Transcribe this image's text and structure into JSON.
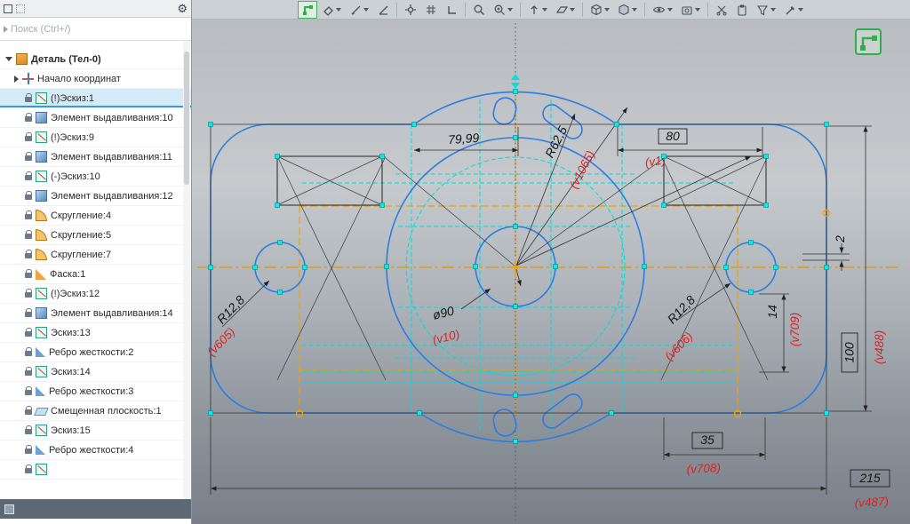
{
  "sidebar": {
    "search": {
      "placeholder": "Поиск (Ctrl+/)"
    },
    "tree": [
      {
        "label": "Деталь (Тел-0)",
        "type": "part"
      },
      {
        "label": "Начало координат",
        "type": "origin"
      },
      {
        "label": "(!)Эскиз:1",
        "type": "sketch",
        "selected": true,
        "locked": true
      },
      {
        "label": "Элемент выдавливания:10",
        "type": "extrude",
        "locked": true
      },
      {
        "label": "(!)Эскиз:9",
        "type": "sketch",
        "locked": true
      },
      {
        "label": "Элемент выдавливания:11",
        "type": "extrude",
        "locked": true
      },
      {
        "label": "(-)Эскиз:10",
        "type": "sketch",
        "locked": true
      },
      {
        "label": "Элемент выдавливания:12",
        "type": "extrude",
        "locked": true
      },
      {
        "label": "Скругление:4",
        "type": "fillet",
        "locked": true
      },
      {
        "label": "Скругление:5",
        "type": "fillet",
        "locked": true
      },
      {
        "label": "Скругление:7",
        "type": "fillet",
        "locked": true
      },
      {
        "label": "Фаска:1",
        "type": "chamfer",
        "locked": true
      },
      {
        "label": "(!)Эскиз:12",
        "type": "sketch",
        "locked": true
      },
      {
        "label": "Элемент выдавливания:14",
        "type": "extrude",
        "locked": true
      },
      {
        "label": "Эскиз:13",
        "type": "sketch",
        "locked": true
      },
      {
        "label": "Ребро жесткости:2",
        "type": "rib",
        "locked": true
      },
      {
        "label": "Эскиз:14",
        "type": "sketch",
        "locked": true
      },
      {
        "label": "Ребро жесткости:3",
        "type": "rib",
        "locked": true
      },
      {
        "label": "Смещенная плоскость:1",
        "type": "plane",
        "locked": true
      },
      {
        "label": "Эскиз:15",
        "type": "sketch",
        "locked": true
      },
      {
        "label": "Ребро жесткости:4",
        "type": "rib",
        "locked": true
      },
      {
        "label": "",
        "type": "sketch",
        "locked": true
      }
    ]
  },
  "toolbar": {
    "buttons": [
      "sketch-mode",
      "eraser",
      "pen-style",
      "angle",
      "snap",
      "grid",
      "corner-axes",
      "zoom",
      "zoom-area",
      "orient",
      "plane-view",
      "iso-cube",
      "display-cube",
      "visibility-eye",
      "camera",
      "cut",
      "clipboard",
      "filter",
      "picker"
    ]
  },
  "viewport": {
    "dimensions": {
      "d7999": "79,99",
      "d80": "80",
      "r625": "R62,5",
      "r128_left": "R12,8",
      "dia90": "ø90",
      "r128_right": "R12,8",
      "d2": "2",
      "d14": "14",
      "d100": "100",
      "d35": "35",
      "d215": "215"
    },
    "variables": {
      "v1065": "(v1065)",
      "v1": "(v1)",
      "v605": "(v605)",
      "v10": "(v10)",
      "v606": "(v606)",
      "v709": "(v709)",
      "v488": "(v488)",
      "v708": "(v708)",
      "v487": "(v487)"
    },
    "colors": {
      "blue_geometry": "#2b7de0",
      "cyan_construction": "#00dcdc",
      "orange_axis": "#f0a000",
      "red_variables": "#e02020",
      "selection": "#d6ebf8",
      "active_green": "#3bb14f"
    }
  }
}
